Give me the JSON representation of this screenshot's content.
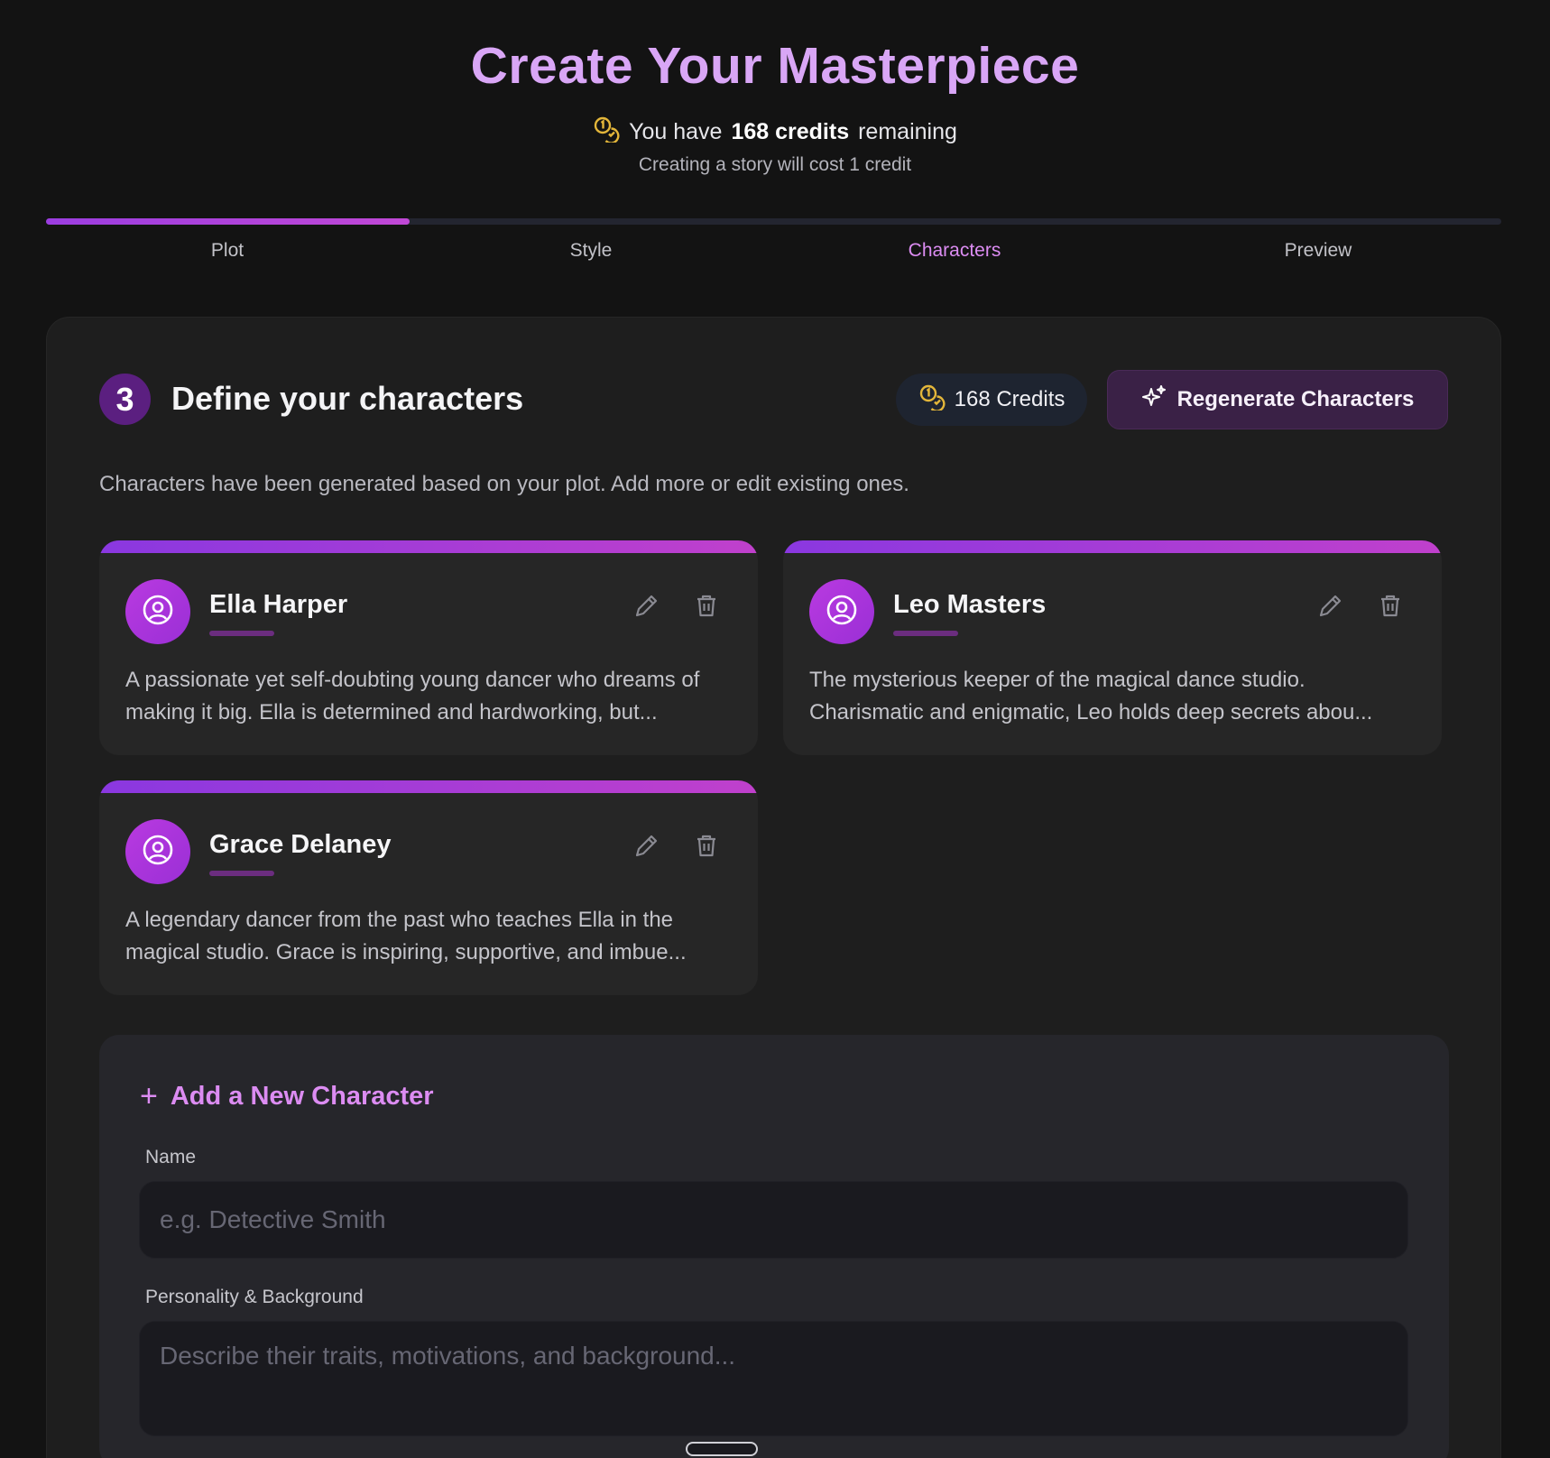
{
  "header": {
    "title": "Create Your Masterpiece",
    "credits_prefix": "You have",
    "credits_bold": "168 credits",
    "credits_suffix": "remaining",
    "cost_note": "Creating a story will cost 1 credit",
    "coin_icon": "coins-icon"
  },
  "progress": {
    "fraction": 0.25,
    "steps": [
      {
        "label": "Plot"
      },
      {
        "label": "Style"
      },
      {
        "label": "Characters",
        "active": true
      },
      {
        "label": "Preview"
      }
    ]
  },
  "section": {
    "step_number": "3",
    "title": "Define your characters",
    "credits_pill": "168 Credits",
    "regenerate_label": "Regenerate Characters",
    "description": "Characters have been generated based on your plot. Add more or edit existing ones."
  },
  "characters": [
    {
      "name": "Ella Harper",
      "description": "A passionate yet self-doubting young dancer who dreams of making it big. Ella is determined and hardworking, but..."
    },
    {
      "name": "Leo Masters",
      "description": "The mysterious keeper of the magical dance studio. Charismatic and enigmatic, Leo holds deep secrets abou..."
    },
    {
      "name": "Grace Delaney",
      "description": "A legendary dancer from the past who teaches Ella in the magical studio. Grace is inspiring, supportive, and imbue..."
    }
  ],
  "add_character": {
    "title": "Add a New Character",
    "name_label": "Name",
    "name_placeholder": "e.g. Detective Smith",
    "background_label": "Personality & Background",
    "background_placeholder": "Describe their traits, motivations, and background..."
  },
  "colors": {
    "accent": "#dc8cf2",
    "title": "#d9a6f6",
    "background": "#131313",
    "panel": "#1e1e1e",
    "card": "#262626",
    "coin": "#e3b63a"
  }
}
